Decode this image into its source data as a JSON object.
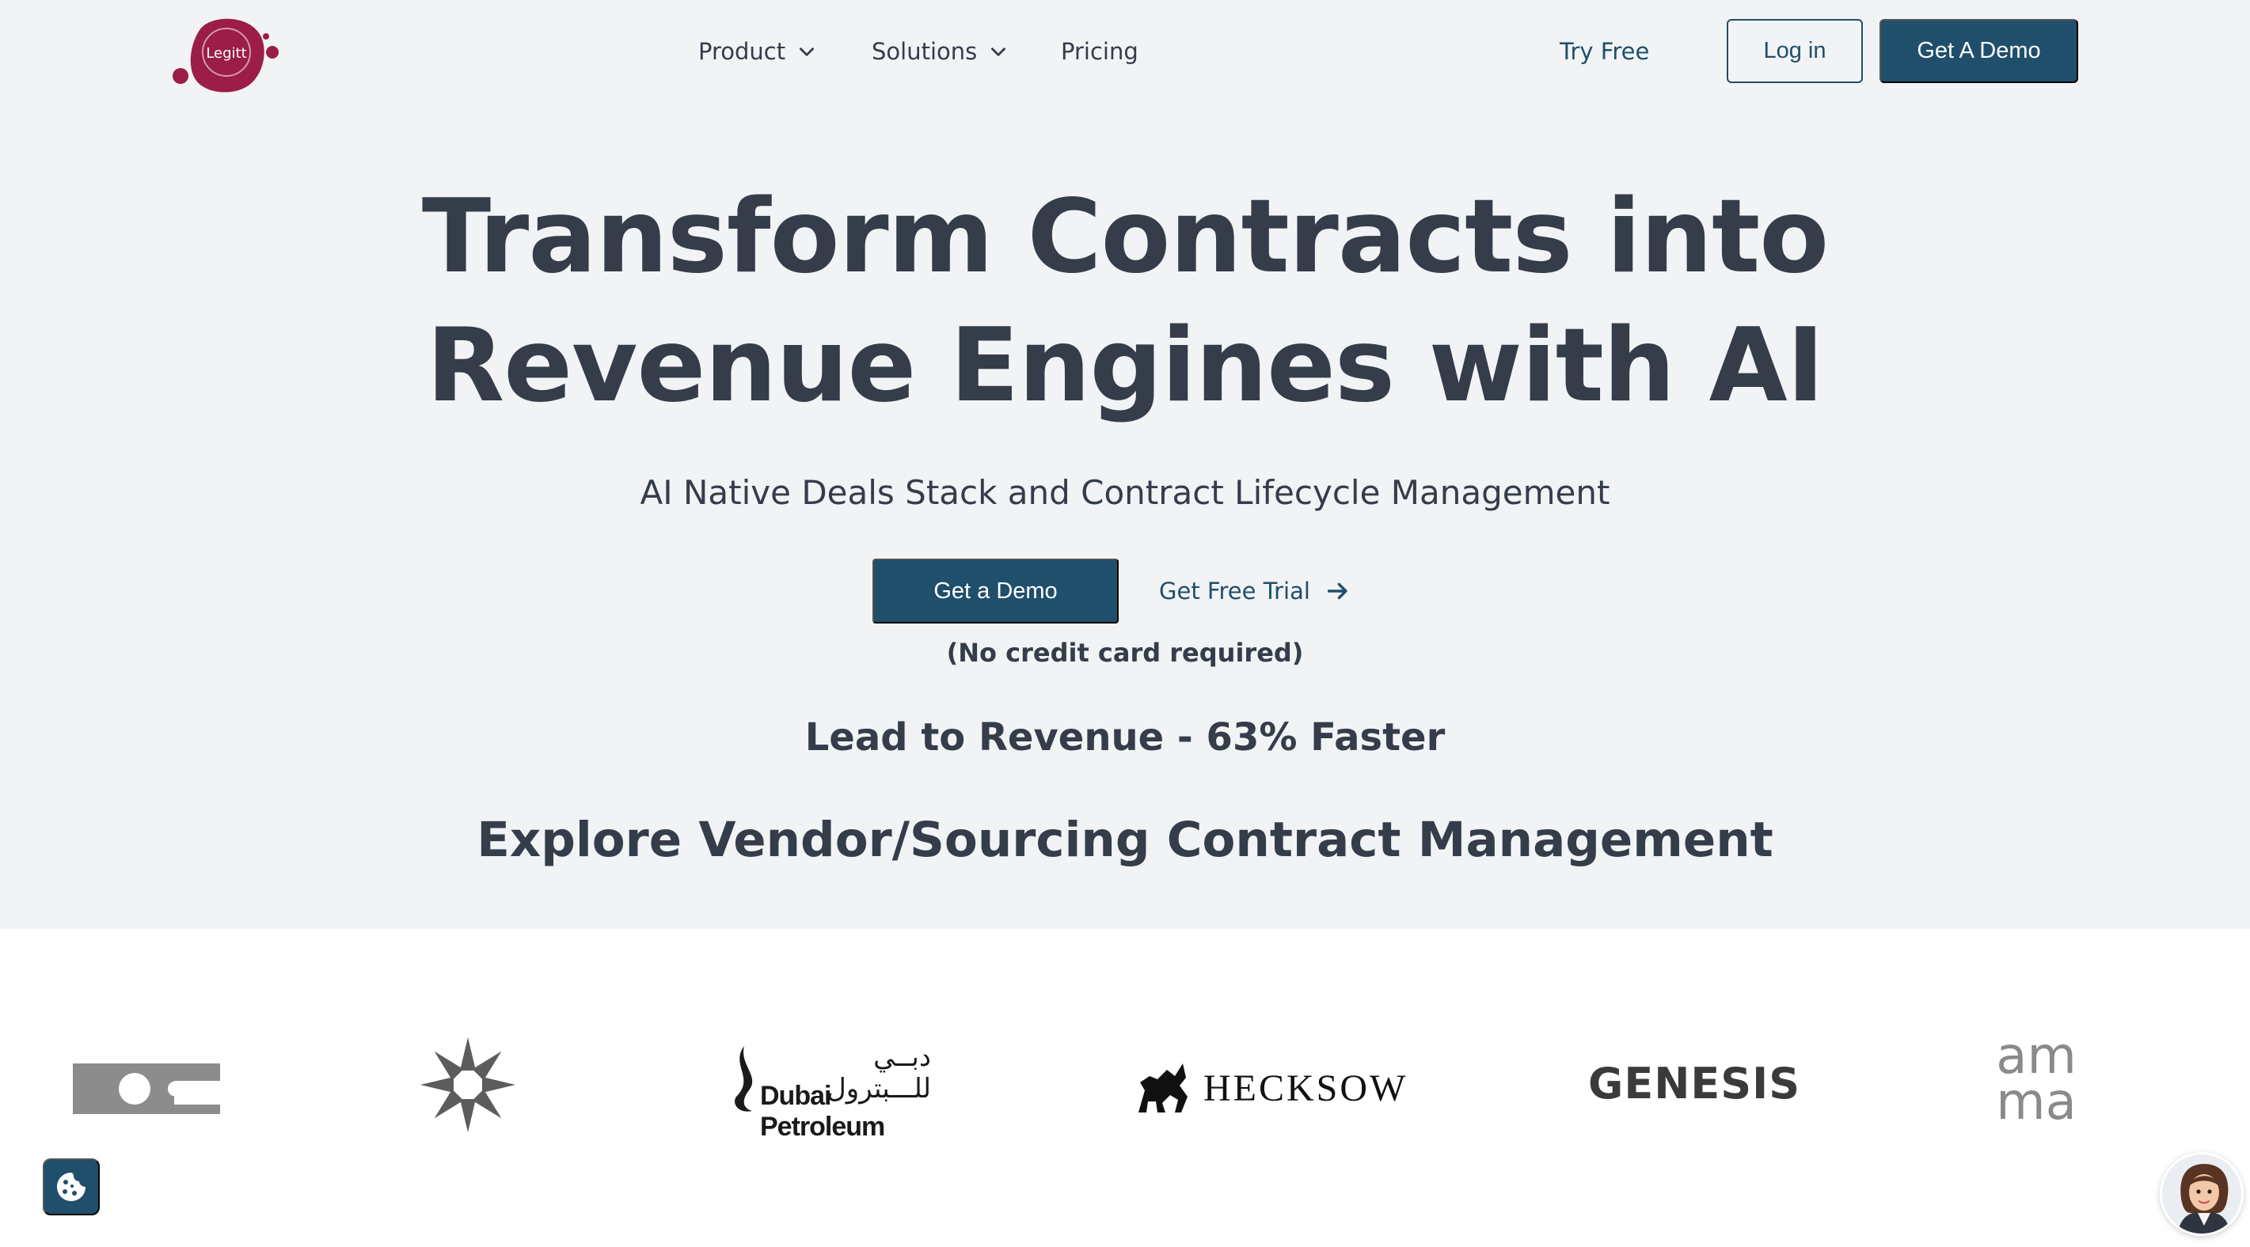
{
  "brand": {
    "logo_text": "Legitt",
    "logo_color": "#9b1d48"
  },
  "nav": {
    "items": [
      {
        "label": "Product",
        "has_dropdown": true
      },
      {
        "label": "Solutions",
        "has_dropdown": true
      },
      {
        "label": "Pricing",
        "has_dropdown": false
      }
    ],
    "try_free": "Try Free",
    "login": "Log in",
    "get_demo": "Get A Demo"
  },
  "hero": {
    "title_line1": "Transform Contracts into",
    "title_line2": "Revenue Engines with AI",
    "subtitle": "AI Native Deals Stack and Contract Lifecycle Management",
    "cta_primary": "Get a Demo",
    "cta_secondary": "Get Free Trial",
    "note": "(No credit card required)",
    "tagline": "Lead to Revenue - 63% Faster",
    "explore": "Explore Vendor/Sourcing Contract Management"
  },
  "client_logos": [
    {
      "name": "ioc-logo-icon"
    },
    {
      "name": "star-emblem-logo-icon"
    },
    {
      "name": "dubai-petroleum-logo",
      "text_ar": "دبــي للـــبترول",
      "text": "Dubai Petroleum"
    },
    {
      "name": "hecksow-logo",
      "text": "HECKSOW"
    },
    {
      "name": "genesis-logo",
      "text": "GENESIS"
    },
    {
      "name": "amma-logo",
      "text_top": "am",
      "text_bottom": "ma"
    }
  ],
  "colors": {
    "primary": "#1f4f6b",
    "text": "#353c4a",
    "hero_bg": "#f1f3f5",
    "logo_gray": "#8c8c8c"
  },
  "icons": {
    "cookie": "cookie-icon",
    "chat": "assistant-avatar-icon",
    "arrow": "arrow-right-icon",
    "chevron": "chevron-down-icon"
  }
}
